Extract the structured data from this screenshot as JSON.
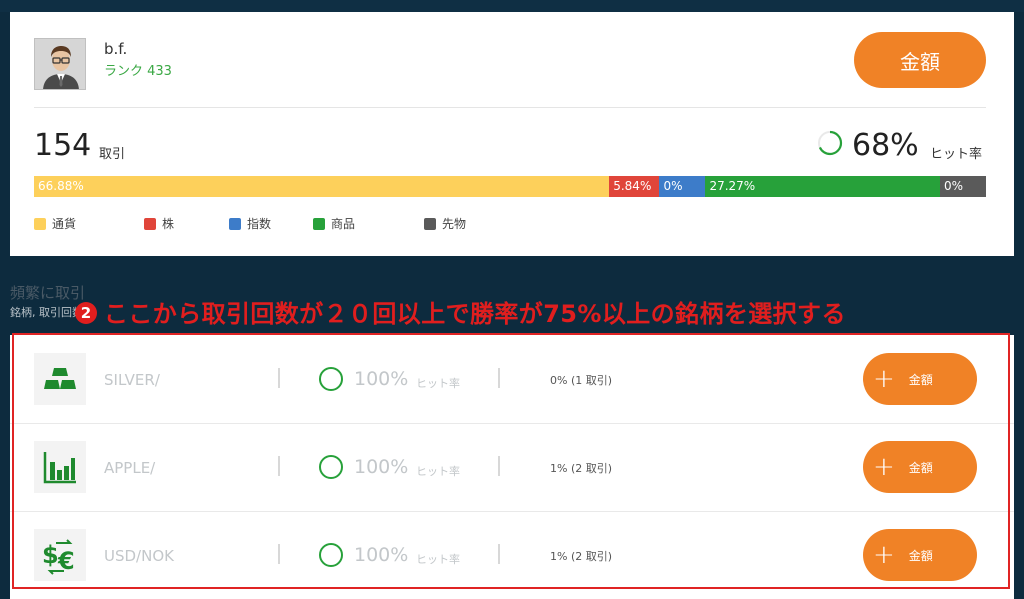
{
  "profile": {
    "name": "b.f.",
    "rank": "ランク 433",
    "amount_button": "金額",
    "trades_count": "154",
    "trades_label": "取引",
    "hit_rate": "68%",
    "hit_label": "ヒット率",
    "hit_fraction": 0.68
  },
  "allocation": [
    {
      "label": "66.88%",
      "value": 66.88,
      "color": "#fdd05b"
    },
    {
      "label": "5.84%",
      "value": 5.84,
      "color": "#e0453a"
    },
    {
      "label": "0%",
      "value": 0,
      "color": "#3d7cc9"
    },
    {
      "label": "27.27%",
      "value": 27.27,
      "color": "#27a13a"
    },
    {
      "label": "0%",
      "value": 0,
      "color": "#5a5a5a"
    }
  ],
  "legend": [
    {
      "label": "通貨",
      "color": "#fdd05b"
    },
    {
      "label": "株",
      "color": "#e0453a"
    },
    {
      "label": "指数",
      "color": "#3d7cc9"
    },
    {
      "label": "商品",
      "color": "#27a13a"
    },
    {
      "label": "先物",
      "color": "#5a5a5a"
    }
  ],
  "section": {
    "title": "頻繁に取引",
    "subtitle": "銘柄, 取引回数"
  },
  "annotation": {
    "number": "2",
    "text": "ここから取引回数が２０回以上で勝率が75%以上の銘柄を選択する"
  },
  "instruments": [
    {
      "name": "SILVER/",
      "hit": "100%",
      "hit_label": "ヒット率",
      "trades": "0% (1 取引)",
      "button": "金額",
      "icon": "silver-bars-icon",
      "hit_fraction": 1.0
    },
    {
      "name": "APPLE/",
      "hit": "100%",
      "hit_label": "ヒット率",
      "trades": "1% (2 取引)",
      "button": "金額",
      "icon": "bar-chart-icon",
      "hit_fraction": 1.0
    },
    {
      "name": "USD/NOK",
      "hit": "100%",
      "hit_label": "ヒット率",
      "trades": "1% (2 取引)",
      "button": "金額",
      "icon": "currency-exchange-icon",
      "hit_fraction": 1.0
    }
  ],
  "colors": {
    "accent": "#f08226",
    "green": "#27a13a",
    "annotation": "#e01e1e",
    "background": "#0d2b3e"
  }
}
